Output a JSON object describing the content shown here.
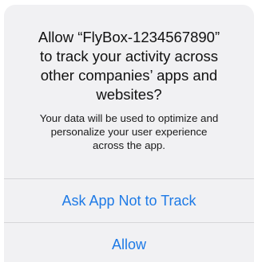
{
  "alert": {
    "title": "Allow “FlyBox-1234567890”\nto track your activity across\nother companies’ apps and\nwebsites?",
    "message": "Your data will be used to optimize and\npersonalize your user experience\nacross the app.",
    "buttons": [
      {
        "label": "Ask App Not to Track"
      },
      {
        "label": "Allow"
      }
    ],
    "colors": {
      "background": "#f1f1f3",
      "button_text": "#1e7ae6",
      "divider": "#d6d6d9"
    }
  }
}
